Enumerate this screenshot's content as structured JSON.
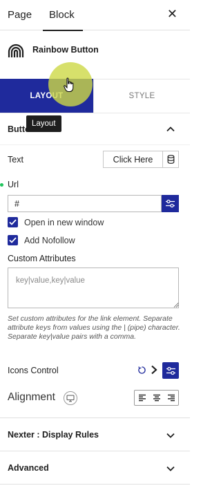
{
  "tabs": {
    "page": "Page",
    "block": "Block"
  },
  "block": {
    "title": "Rainbow Button"
  },
  "mode_tabs": {
    "layout": "LAYOUT",
    "style": "STYLE"
  },
  "tooltip": "Layout",
  "section": {
    "title": "Button"
  },
  "text_field": {
    "label": "Text",
    "value": "Click Here"
  },
  "url_field": {
    "label": "Url",
    "value": "#"
  },
  "checkboxes": [
    {
      "label": "Open in new window",
      "checked": true
    },
    {
      "label": "Add Nofollow",
      "checked": true
    }
  ],
  "custom_attributes": {
    "label": "Custom Attributes",
    "placeholder": "key|value,key|value",
    "help": "Set custom attributes for the link element. Separate attribute keys from values using the | (pipe) character. Separate key|value pairs with a comma."
  },
  "icons_control": {
    "label": "Icons Control"
  },
  "alignment": {
    "label": "Alignment"
  },
  "panels": {
    "display_rules": "Nexter : Display Rules",
    "advanced": "Advanced"
  },
  "colors": {
    "accent": "#1f2a9c",
    "status_dot": "#22c55e",
    "highlight": "#cdd846"
  },
  "icons": [
    "rainbow-icon",
    "close-icon",
    "chevron-up-icon",
    "database-icon",
    "sliders-icon",
    "check-icon",
    "reset-icon",
    "arrow-right-icon",
    "desktop-icon",
    "align-left-icon",
    "align-center-icon",
    "align-right-icon",
    "chevron-down-icon",
    "hand-cursor-icon"
  ]
}
